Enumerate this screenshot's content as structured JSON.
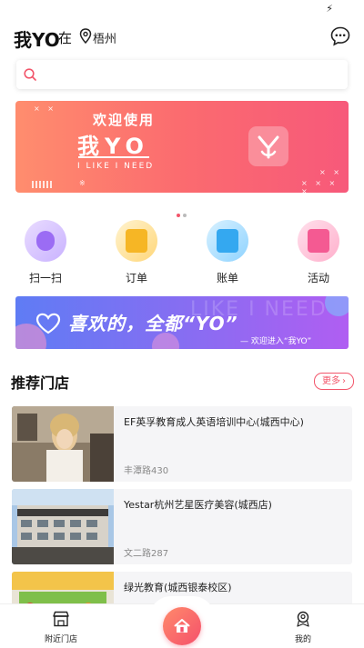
{
  "status": {
    "icon": "charging-bolt-icon"
  },
  "header": {
    "brand": "我YO",
    "at_label": "在",
    "city": "梧州",
    "message_icon": "chat-bubble-icon",
    "location_icon": "location-pin-icon"
  },
  "search": {
    "icon": "search-icon",
    "placeholder": ""
  },
  "banner": {
    "line1": "欢迎使用",
    "line2": "我YO",
    "line3": "I LIKE I NEED",
    "indicator_count": 2,
    "active_index": 0
  },
  "quick_actions": [
    {
      "label": "扫一扫",
      "icon": "scan-icon"
    },
    {
      "label": "订单",
      "icon": "order-icon"
    },
    {
      "label": "账单",
      "icon": "bill-icon"
    },
    {
      "label": "活动",
      "icon": "activity-bag-icon"
    }
  ],
  "promo": {
    "headline": "喜欢的，全都“YO”",
    "subline": "— 欢迎进入“我YO”",
    "ghost_text": "LIKE I NEED"
  },
  "recommended": {
    "title": "推荐门店",
    "more_label": "更多",
    "stores": [
      {
        "name": "EF英孚教育成人英语培训中心(城西中心)",
        "address": "丰潭路430"
      },
      {
        "name": "Yestar杭州艺星医疗美容(城西店)",
        "address": "文二路287"
      },
      {
        "name": "绿光教育(城西银泰校区)",
        "address": ""
      }
    ]
  },
  "tabbar": {
    "left_label": "附近门店",
    "right_label": "我的"
  },
  "colors": {
    "accent": "#f2556a",
    "banner_start": "#ff8d6e",
    "banner_end": "#f7597a",
    "promo_start": "#5f7cf4",
    "promo_end": "#b05ef2"
  }
}
